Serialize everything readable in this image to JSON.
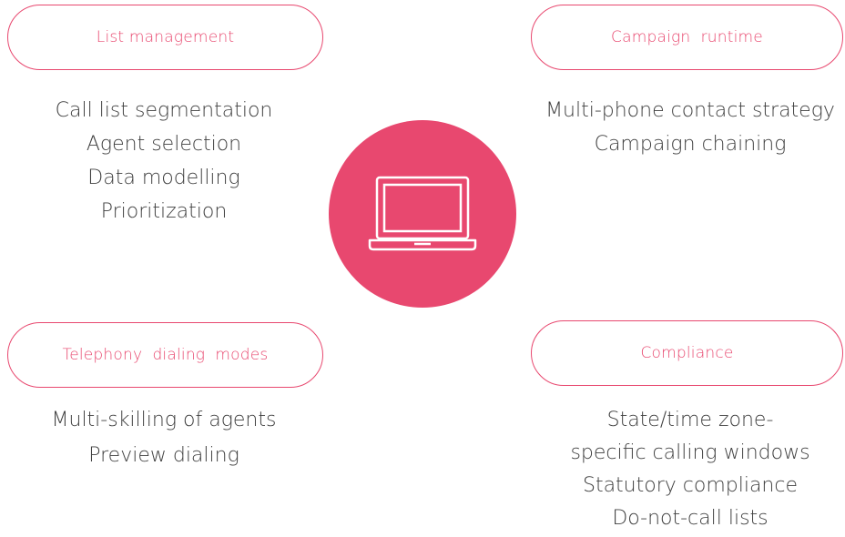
{
  "colors": {
    "accent": "#e8486f",
    "text": "#404040",
    "background": "#ffffff"
  },
  "hub": {
    "icon": "laptop-icon"
  },
  "quadrants": {
    "list_management": {
      "title": "List management",
      "items": [
        "Call list segmentation",
        "Agent selection",
        "Data modelling",
        "Prioritization"
      ]
    },
    "campaign_runtime": {
      "title": "Campaign  runtime",
      "items": [
        "Multi-phone contact strategy",
        "Campaign chaining"
      ]
    },
    "telephony": {
      "title": "Telephony  dialing  modes",
      "items": [
        "Multi-skilling of agents",
        "Preview dialing"
      ]
    },
    "compliance": {
      "title": "Compliance",
      "items": [
        "State/time zone-",
        "specific calling windows",
        "Statutory compliance",
        "Do-not-call lists"
      ]
    }
  }
}
